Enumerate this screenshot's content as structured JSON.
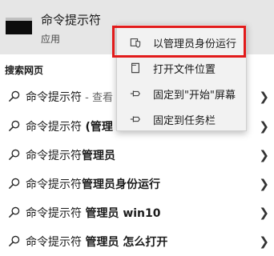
{
  "app": {
    "title": "命令提示符",
    "type": "应用"
  },
  "section_title": "搜索网页",
  "results": [
    {
      "prefix": "命令提示符",
      "bold": "",
      "suffix": " - 查看",
      "icon": "search-icon"
    },
    {
      "prefix": "命令提示符 ",
      "bold": "(管理",
      "suffix": "",
      "icon": "search-icon"
    },
    {
      "prefix": "命令提示符",
      "bold": "管理员",
      "suffix": "",
      "icon": "search-icon"
    },
    {
      "prefix": "命令提示符",
      "bold": "管理员身份运行",
      "suffix": "",
      "icon": "search-icon"
    },
    {
      "prefix": "命令提示符 ",
      "bold": "管理员 win10",
      "suffix": "",
      "icon": "search-icon"
    },
    {
      "prefix": "命令提示符 ",
      "bold": "管理员 怎么打开",
      "suffix": "",
      "icon": "search-icon"
    }
  ],
  "context_menu": {
    "items": [
      {
        "label": "以管理员身份运行",
        "icon": "shield-icon"
      },
      {
        "label": "打开文件位置",
        "icon": "folder-icon"
      },
      {
        "label": "固定到\"开始\"屏幕",
        "icon": "pin-icon"
      },
      {
        "label": "固定到任务栏",
        "icon": "pin-icon"
      }
    ]
  },
  "colors": {
    "highlight_border": "#e21b1b",
    "top_background": "#e6e6e6"
  }
}
